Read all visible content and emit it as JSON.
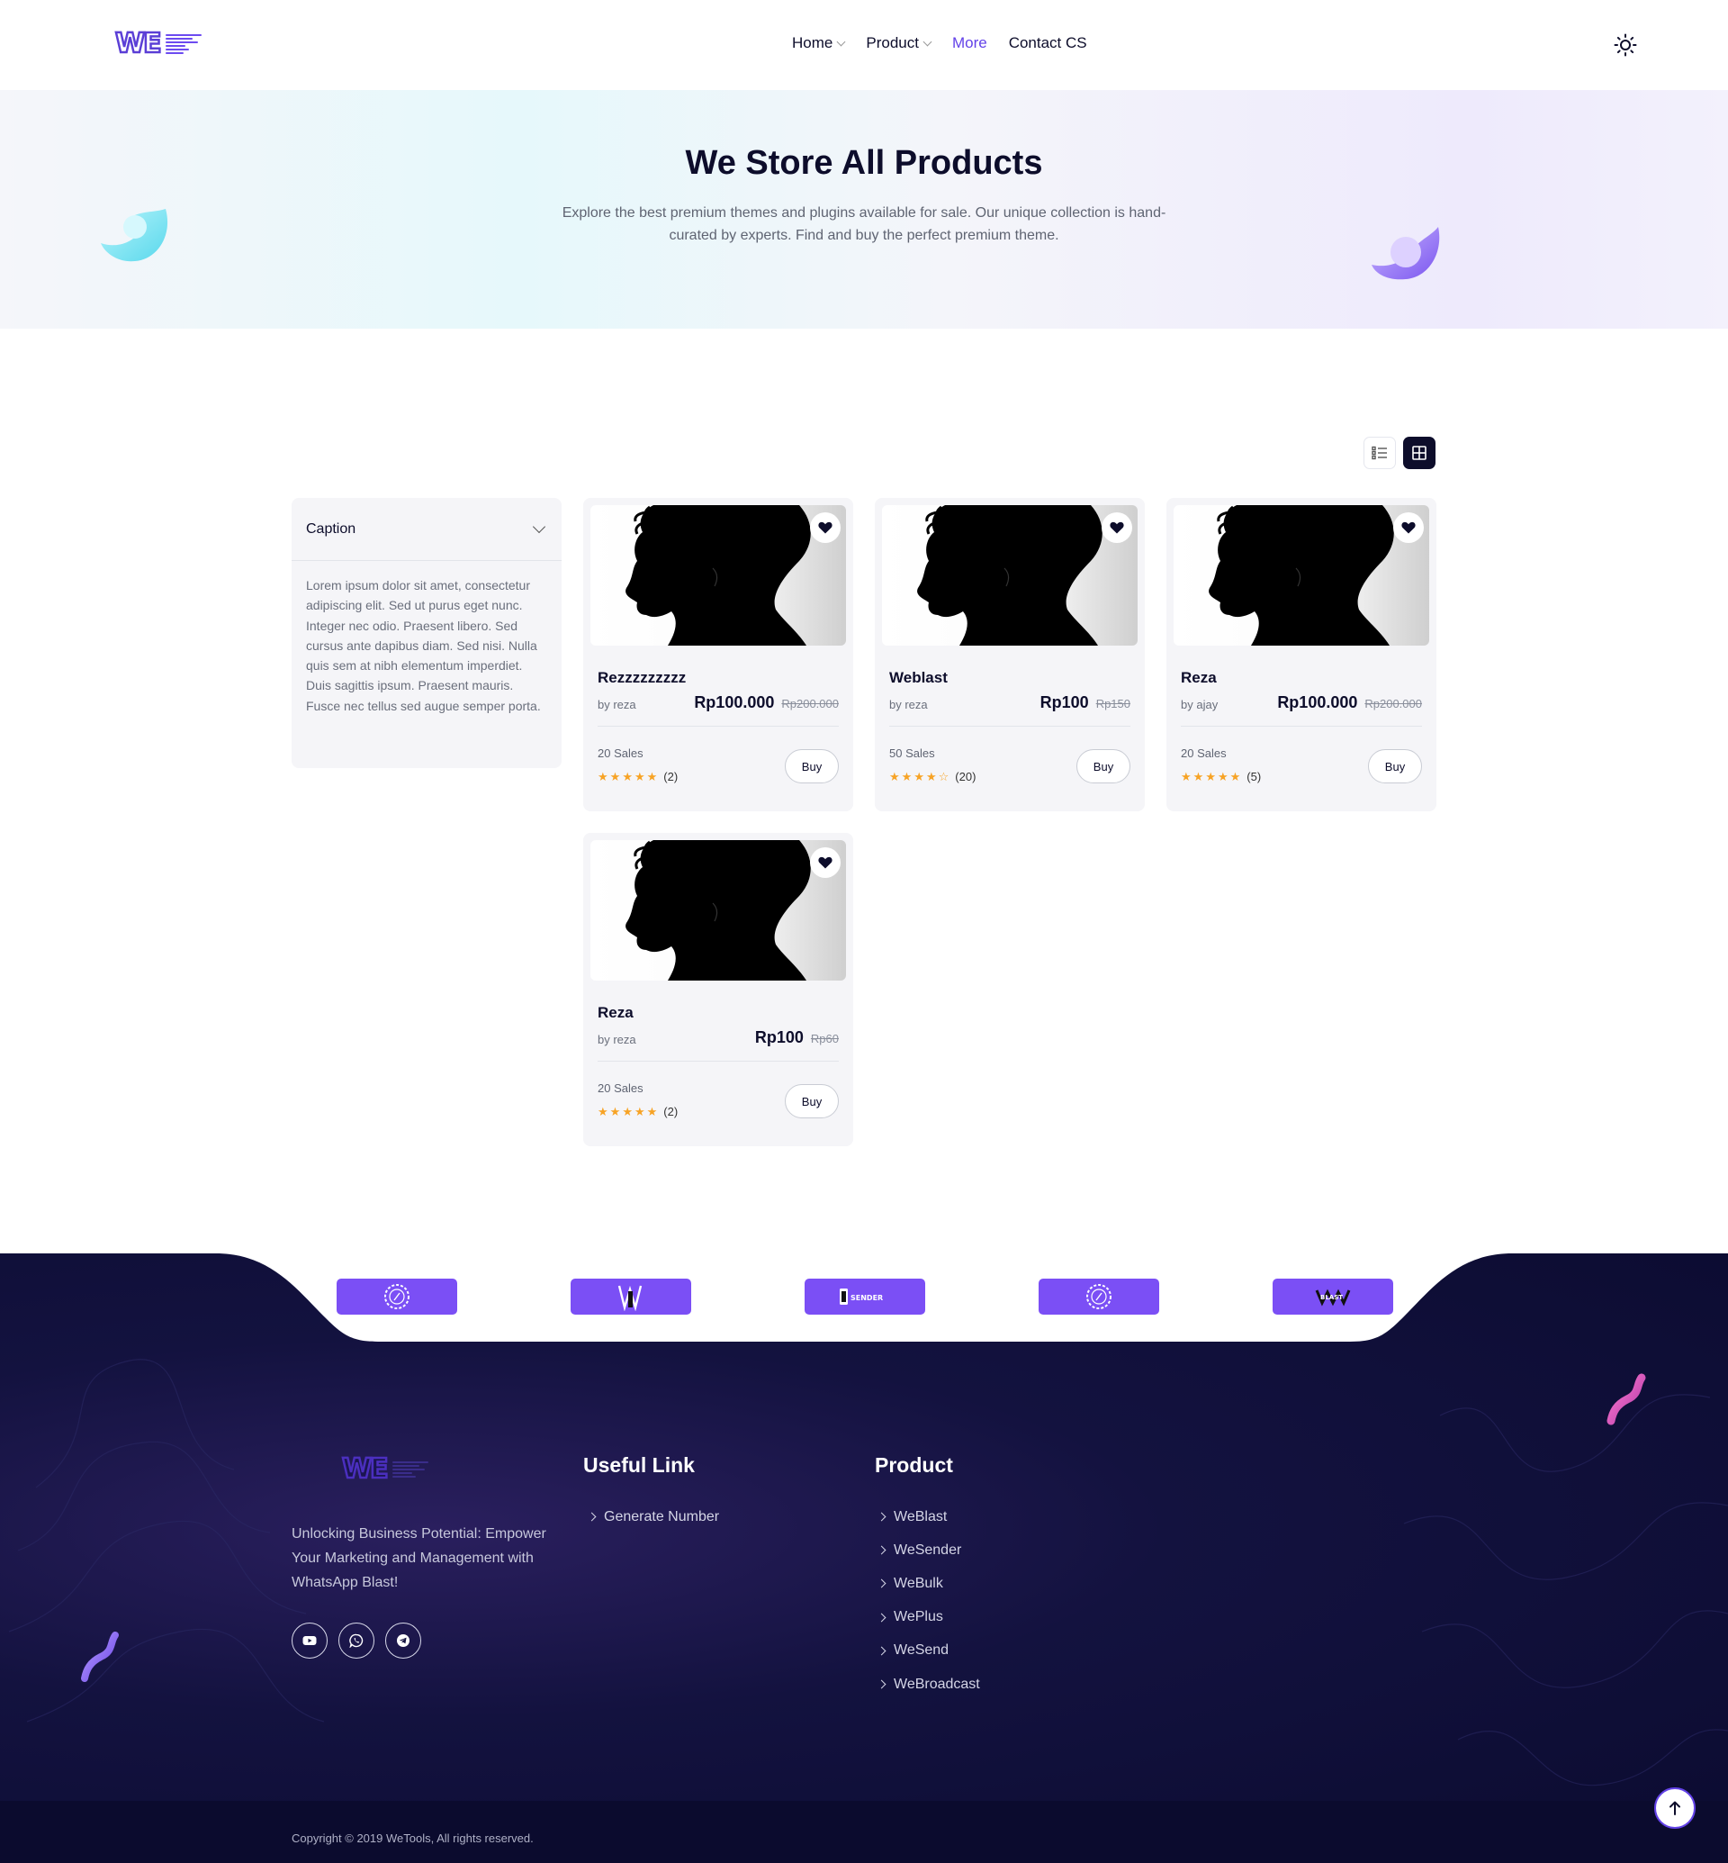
{
  "header": {
    "logo_text": "WE",
    "nav": [
      {
        "label": "Home",
        "has_dropdown": true
      },
      {
        "label": "Product",
        "has_dropdown": true
      },
      {
        "label": "More",
        "has_dropdown": false,
        "active": true
      },
      {
        "label": "Contact CS",
        "has_dropdown": false
      }
    ],
    "theme_icon": "sun-icon"
  },
  "hero": {
    "title": "We Store All Products",
    "subtitle": "Explore the best premium themes and plugins available for sale. Our unique collection is hand-curated by experts. Find and buy the perfect premium theme."
  },
  "view_toggle": {
    "options": [
      {
        "icon": "list-view-icon",
        "active": false
      },
      {
        "icon": "grid-view-icon",
        "active": true
      }
    ]
  },
  "sidebar": {
    "caption_title": "Caption",
    "caption_body": "Lorem ipsum dolor sit amet, consectetur adipiscing elit. Sed ut purus eget nunc. Integer nec odio. Praesent libero. Sed cursus ante dapibus diam. Sed nisi. Nulla quis sem at nibh elementum imperdiet. Duis sagittis ipsum. Praesent mauris. Fusce nec tellus sed augue semper porta."
  },
  "products": [
    {
      "title": "Rezzzzzzzzz",
      "author": "by reza",
      "price": "Rp100.000",
      "old_price": "Rp200.000",
      "sales": "20 Sales",
      "rating": 5,
      "rating_count": "(2)",
      "buy_label": "Buy"
    },
    {
      "title": "Weblast",
      "author": "by reza",
      "price": "Rp100",
      "old_price": "Rp150",
      "sales": "50 Sales",
      "rating": 4,
      "rating_count": "(20)",
      "buy_label": "Buy"
    },
    {
      "title": "Reza",
      "author": "by ajay",
      "price": "Rp100.000",
      "old_price": "Rp200.000",
      "sales": "20 Sales",
      "rating": 5,
      "rating_count": "(5)",
      "buy_label": "Buy"
    },
    {
      "title": "Reza",
      "author": "by reza",
      "price": "Rp100",
      "old_price": "Rp60",
      "sales": "20 Sales",
      "rating": 5,
      "rating_count": "(2)",
      "buy_label": "Buy"
    }
  ],
  "partners": [
    {
      "icon": "badge-logo-icon"
    },
    {
      "icon": "wf-logo-icon"
    },
    {
      "icon": "sender-logo-icon",
      "label": "SENDER"
    },
    {
      "icon": "badge-logo-icon"
    },
    {
      "icon": "blast-logo-icon",
      "label": "BLAST"
    }
  ],
  "footer": {
    "logo_text": "WE",
    "tagline": "Unlocking Business Potential: Empower Your Marketing and Management with WhatsApp Blast!",
    "socials": [
      {
        "icon": "youtube-icon"
      },
      {
        "icon": "whatsapp-icon"
      },
      {
        "icon": "telegram-icon"
      }
    ],
    "useful_link": {
      "title": "Useful Link",
      "links": [
        "Generate Number"
      ]
    },
    "product": {
      "title": "Product",
      "links": [
        "WeBlast",
        "WeSender",
        "WeBulk",
        "WePlus",
        "WeSend",
        "WeBroadcast"
      ]
    },
    "copyright": "Copyright © 2019 WeTools, All rights reserved."
  },
  "colors": {
    "accent": "#6342e8",
    "dark": "#0d0d2b",
    "star": "#f7a325",
    "partner_bg": "#7b4ff5"
  }
}
